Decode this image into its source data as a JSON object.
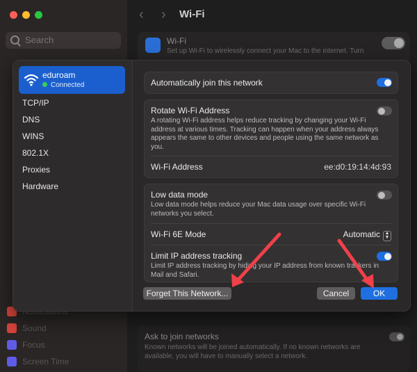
{
  "background": {
    "search_placeholder": "Search",
    "header_title": "Wi-Fi",
    "wifi_card": {
      "title": "Wi-Fi",
      "description": "Set up Wi-Fi to wirelessly connect your Mac to the internet. Turn"
    },
    "sidebar_items": [
      {
        "label": "Notifications",
        "color": "#d9443a"
      },
      {
        "label": "Sound",
        "color": "#d9443a"
      },
      {
        "label": "Focus",
        "color": "#5e5ce6"
      },
      {
        "label": "Screen Time",
        "color": "#5e5ce6"
      }
    ],
    "ask_to_join": {
      "title": "Ask to join networks",
      "description": "Known networks will be joined automatically. If no known networks are available, you will have to manually select a network."
    }
  },
  "sheet": {
    "network": {
      "name": "eduroam",
      "status": "Connected",
      "status_color": "#37d058"
    },
    "sidebar_links": [
      "TCP/IP",
      "DNS",
      "WINS",
      "802.1X",
      "Proxies",
      "Hardware"
    ],
    "auto_join": {
      "label": "Automatically join this network",
      "on": true
    },
    "rotate_address": {
      "label": "Rotate Wi-Fi Address",
      "description": "A rotating Wi-Fi address helps reduce tracking by changing your Wi-Fi address at various times. Tracking can happen when your address always appears the same to other devices and people using the same network as you.",
      "on": false
    },
    "wifi_address": {
      "label": "Wi-Fi Address",
      "value": "ee:d0:19:14:4d:93"
    },
    "low_data": {
      "label": "Low data mode",
      "description": "Low data mode helps reduce your Mac data usage over specific Wi-Fi networks you select.",
      "on": false
    },
    "wifi_6e": {
      "label": "Wi-Fi 6E Mode",
      "value": "Automatic"
    },
    "limit_ip": {
      "label": "Limit IP address tracking",
      "description": "Limit IP address tracking by hiding your IP address from known trackers in Mail and Safari.",
      "on": true
    },
    "buttons": {
      "forget": "Forget This Network...",
      "cancel": "Cancel",
      "ok": "OK"
    }
  },
  "colors": {
    "accent": "#1f6fe0",
    "annotation_arrow": "#f0404a"
  }
}
